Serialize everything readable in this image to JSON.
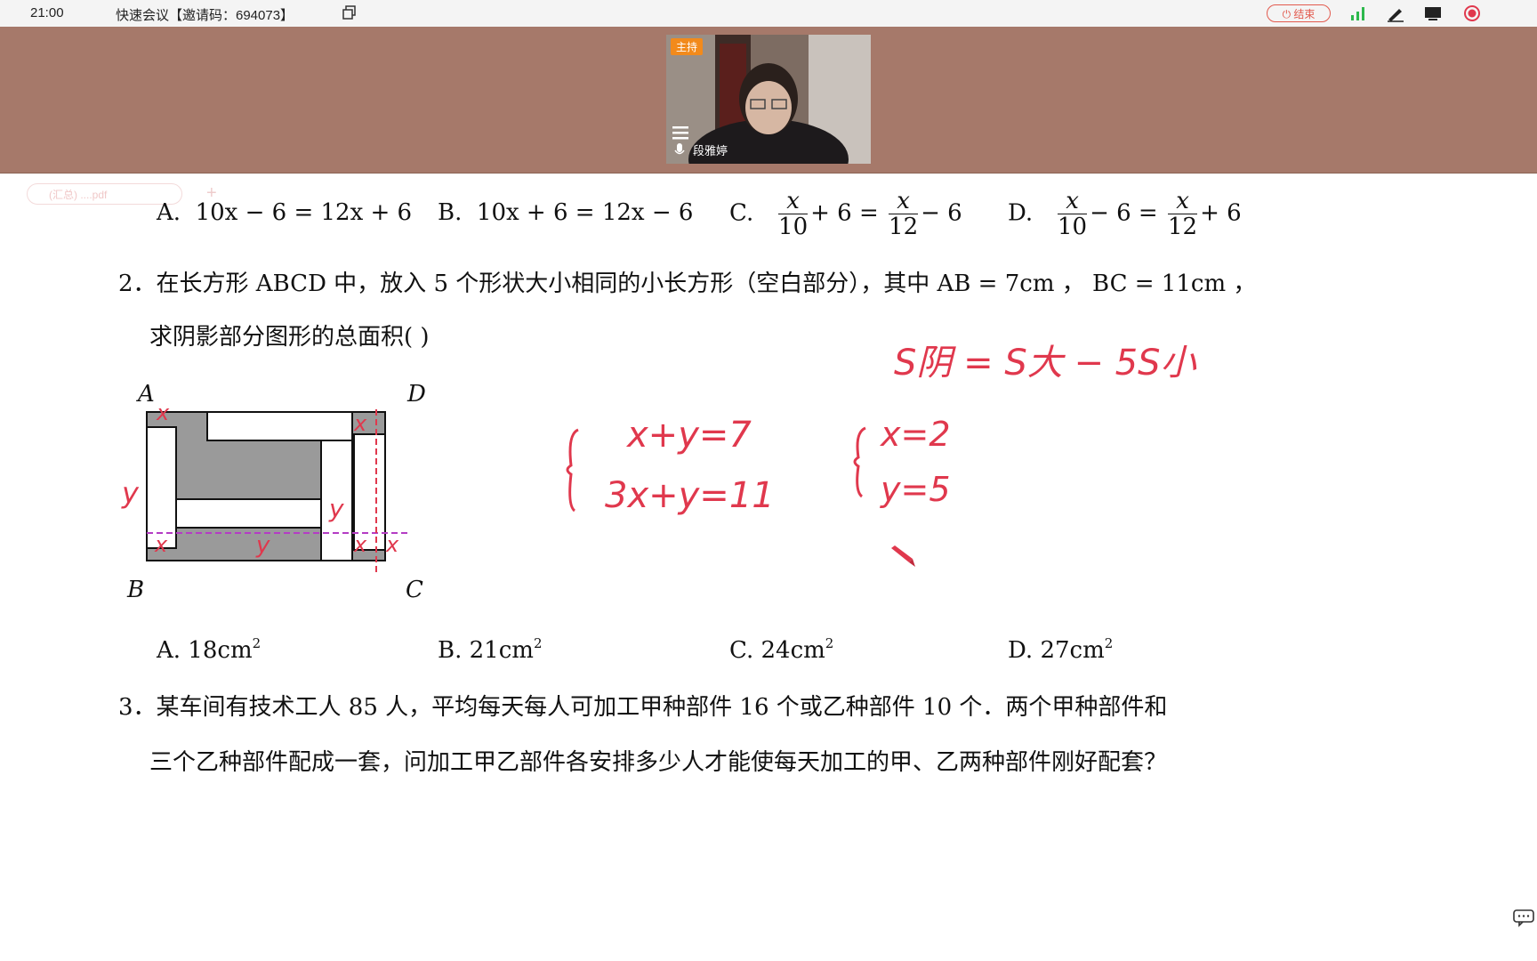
{
  "topbar": {
    "time": "21:00",
    "title": "快速会议【邀请码：694073】",
    "end_label": "结束"
  },
  "meeting": {
    "host_badge": "主持",
    "participant_name": "段雅婷"
  },
  "doc_tab": {
    "label": "(汇总) ....pdf"
  },
  "q1_options": {
    "a_label": "A.",
    "a_expr": "10x − 6 = 12x + 6",
    "b_label": "B.",
    "b_expr": "10x + 6 = 12x − 6",
    "c_label": "C.",
    "d_label": "D."
  },
  "q2": {
    "line1": "2．在长方形 ABCD 中，放入 5 个形状大小相同的小长方形（空白部分），其中 AB = 7cm ，  BC = 11cm ，",
    "line2": "求阴影部分图形的总面积(            )",
    "vertex_a": "A",
    "vertex_b": "B",
    "vertex_c": "C",
    "vertex_d": "D",
    "opt_a": "A.   18cm",
    "opt_b": "B.   21cm",
    "opt_c": "C.   24cm",
    "opt_d": "D.   27cm",
    "sup": "2"
  },
  "q3": {
    "line1": "3．某车间有技术工人 85 人，平均每天每人可加工甲种部件 16 个或乙种部件 10 个．两个甲种部件和",
    "line2": "三个乙种部件配成一套，问加工甲乙部件各安排多少人才能使每天加工的甲、乙两种部件刚好配套？"
  },
  "handwriting": {
    "formula": "S阴 = S大 − 5S小",
    "eq1": "x+y=7",
    "eq2": "3x+y=11",
    "sol1": "x=2",
    "sol2": "y=5",
    "mark_x": "x",
    "mark_y": "y"
  },
  "colors": {
    "meeting_bg": "#a6796a",
    "annotation": "#e0384d",
    "end_button": "#e25a4e"
  }
}
